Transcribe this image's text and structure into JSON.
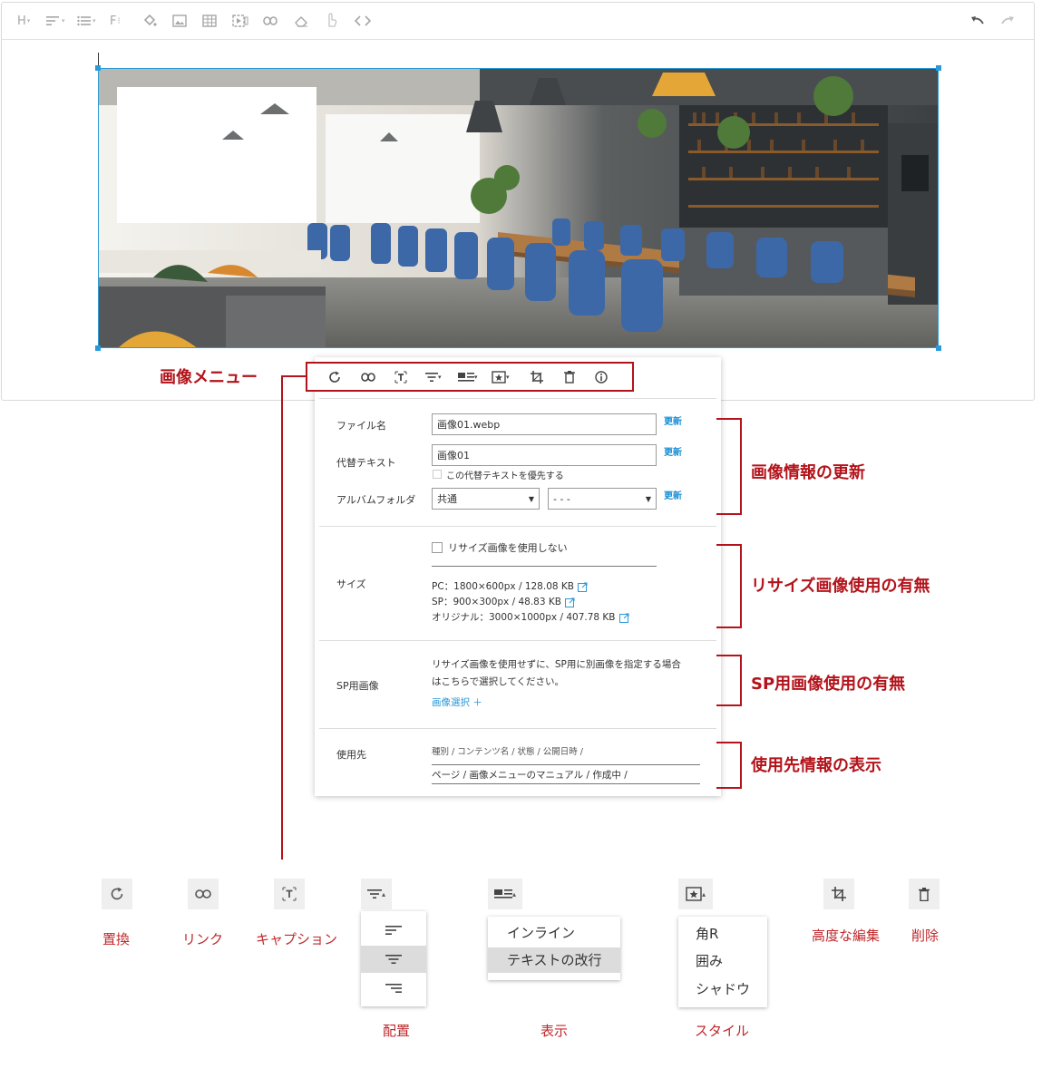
{
  "toolbar": {
    "heading_label": "H",
    "font_label": "F"
  },
  "panel": {
    "filename_label": "ファイル名",
    "filename_value": "画像01.webp",
    "alt_label": "代替テキスト",
    "alt_value": "画像01",
    "alt_priority_label": "この代替テキストを優先する",
    "album_label": "アルバムフォルダ",
    "album_value": "共通",
    "album_sub_value": "- - -",
    "update_label": "更新",
    "size_label": "サイズ",
    "no_resize_label": "リサイズ画像を使用しない",
    "size_pc": "PC：1800×600px / 128.08 KB",
    "size_sp": "SP：900×300px / 48.83 KB",
    "size_orig": "オリジナル：3000×1000px / 407.78 KB",
    "sp_image_label": "SP用画像",
    "sp_desc_1": "リサイズ画像を使用せずに、SP用に別画像を指定する場合",
    "sp_desc_2": "はこちらで選択してください。",
    "sp_select": "画像選択 ＋",
    "usage_label": "使用先",
    "usage_header": "種別 / コンテンツ名 / 状態 / 公開日時 /",
    "usage_row": "ページ / 画像メニューのマニュアル / 作成中 /"
  },
  "annotations": {
    "image_menu": "画像メニュー",
    "info_update": "画像情報の更新",
    "resize_usage": "リサイズ画像使用の有無",
    "sp_usage": "SP用画像使用の有無",
    "usage_info": "使用先情報の表示"
  },
  "legend": {
    "replace": "置換",
    "link": "リンク",
    "caption": "キャプション",
    "align": "配置",
    "display": "表示",
    "display_options": [
      "インライン",
      "テキストの改行"
    ],
    "style": "スタイル",
    "style_options": [
      "角R",
      "囲み",
      "シャドウ"
    ],
    "advanced_edit": "高度な編集",
    "delete": "削除"
  },
  "colors": {
    "accent": "#2a9ad8",
    "annotation": "#b3131a",
    "link": "#1a8fd4"
  }
}
